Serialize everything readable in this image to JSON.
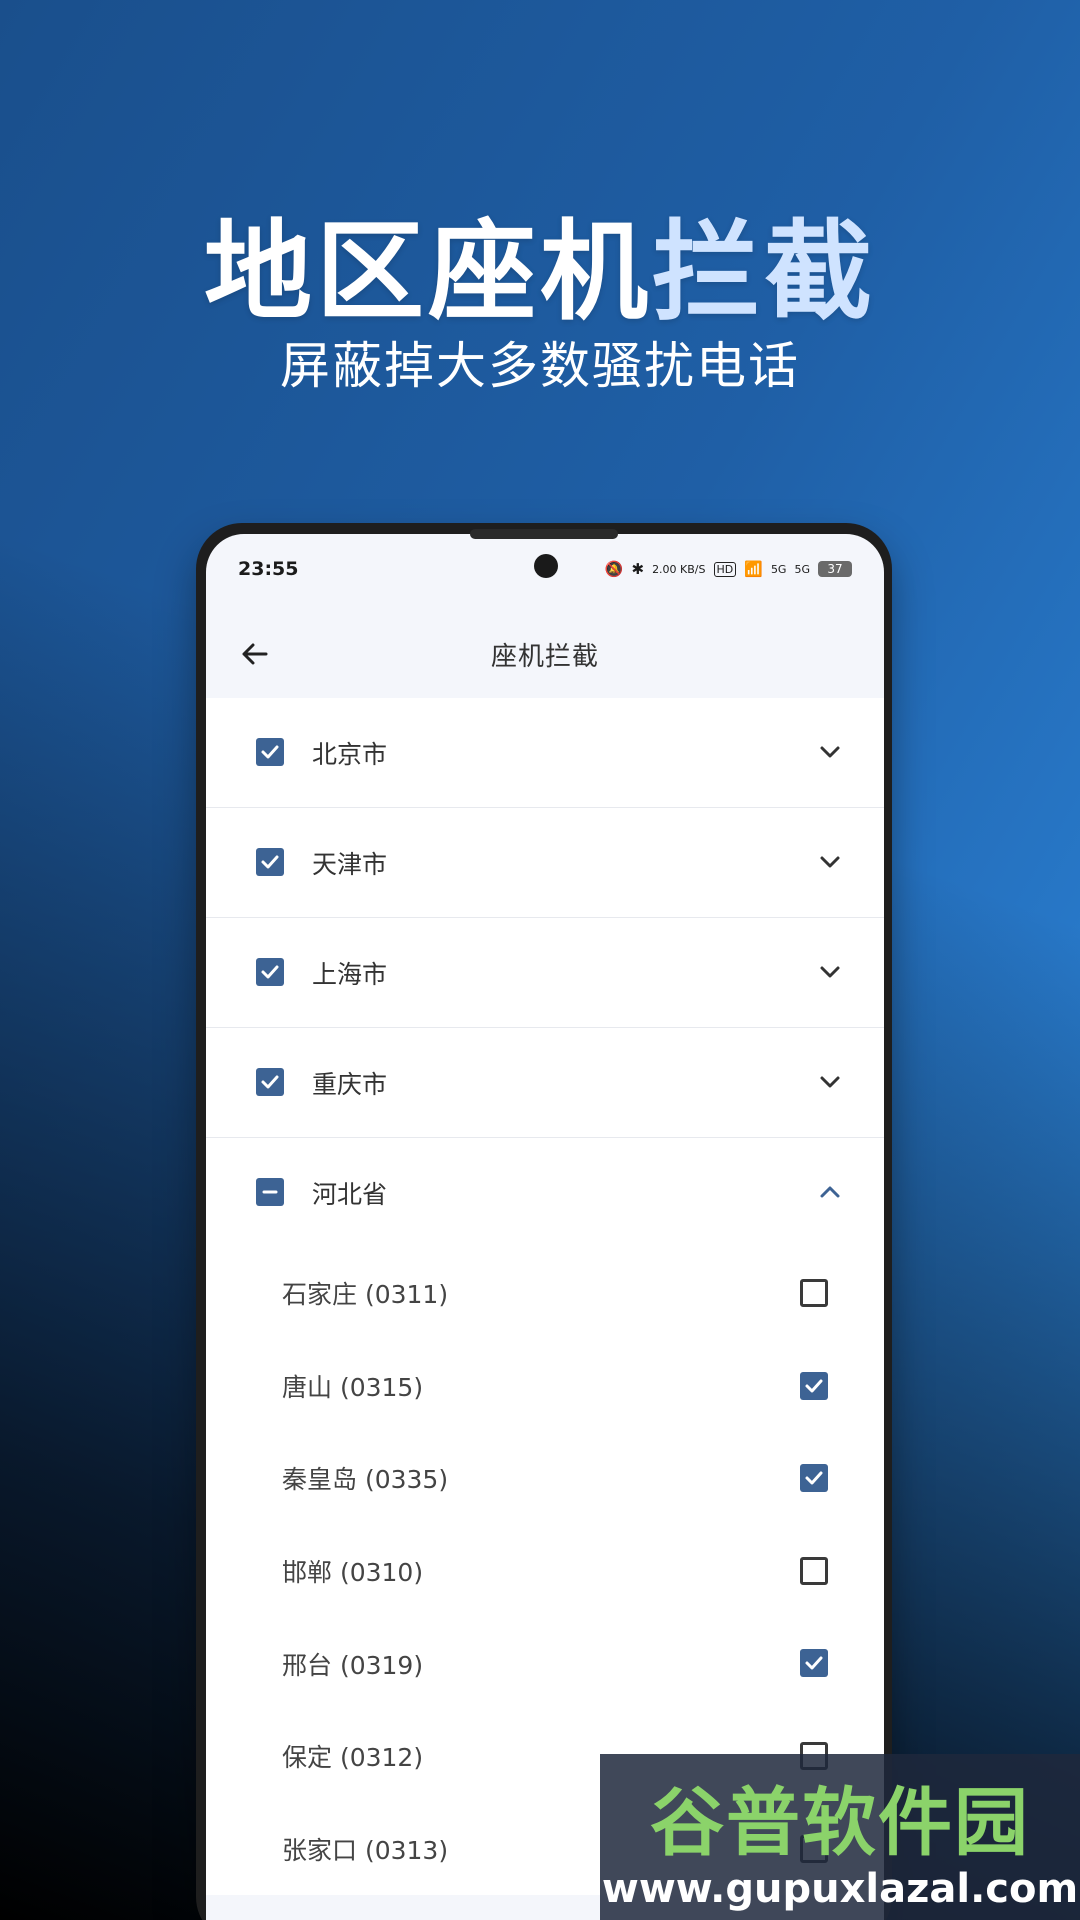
{
  "promo": {
    "headline_main": "地区座机",
    "headline_fade": "拦截",
    "subline": "屏蔽掉大多数骚扰电话"
  },
  "status": {
    "time": "23:55",
    "speed": "2.00 KB/S",
    "hd": "HD",
    "net1": "5G",
    "net2": "5G",
    "battery": "37"
  },
  "appbar": {
    "title": "座机拦截"
  },
  "provinces": [
    {
      "label": "北京市",
      "state": "checked",
      "expanded": false
    },
    {
      "label": "天津市",
      "state": "checked",
      "expanded": false
    },
    {
      "label": "上海市",
      "state": "checked",
      "expanded": false
    },
    {
      "label": "重庆市",
      "state": "checked",
      "expanded": false
    },
    {
      "label": "河北省",
      "state": "partial",
      "expanded": true
    }
  ],
  "cities": [
    {
      "label": "石家庄 (0311)",
      "checked": false
    },
    {
      "label": "唐山 (0315)",
      "checked": true
    },
    {
      "label": "秦皇岛 (0335)",
      "checked": true
    },
    {
      "label": "邯郸 (0310)",
      "checked": false
    },
    {
      "label": "邢台 (0319)",
      "checked": true
    },
    {
      "label": "保定 (0312)",
      "checked": false
    },
    {
      "label": "张家口 (0313)",
      "checked": false
    }
  ],
  "watermark": {
    "name": "谷普软件园",
    "url": "www.gupuxlazal.com"
  },
  "colors": {
    "accent": "#3d6394",
    "bg_top": "#2f8ee6",
    "bg_dark": "#0a1420"
  }
}
